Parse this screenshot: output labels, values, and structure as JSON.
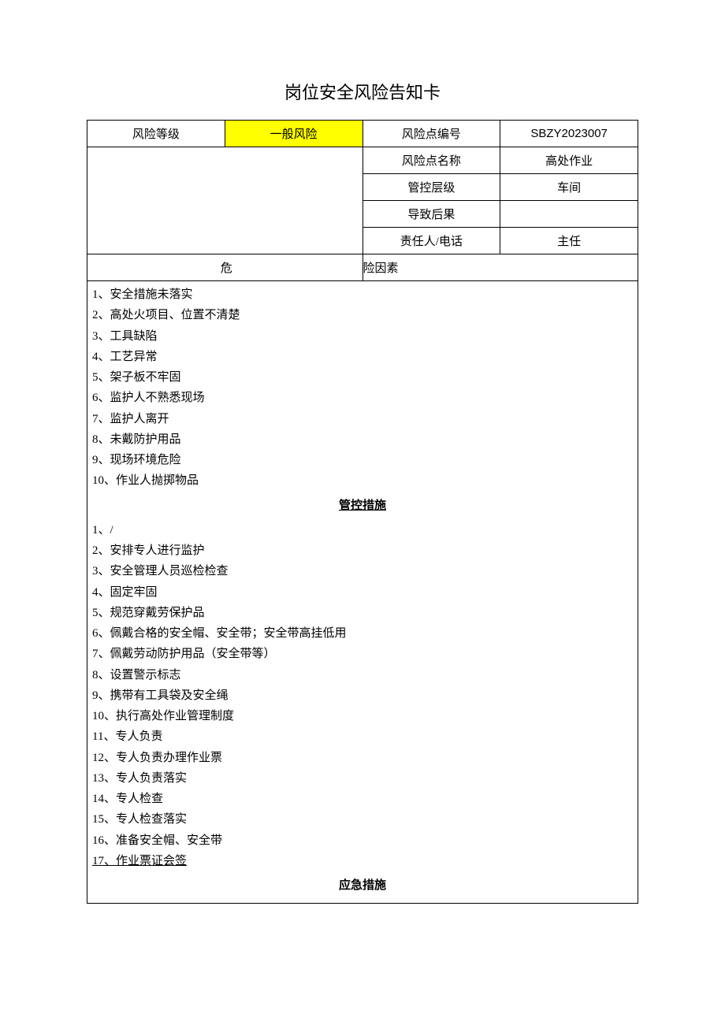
{
  "title": "岗位安全风险告知卡",
  "header": {
    "risk_level_label": "风险等级",
    "risk_level_value": "一般风险",
    "risk_point_no_label": "风险点编号",
    "risk_point_no_value": "SBZY2023007",
    "risk_point_name_label": "风险点名称",
    "risk_point_name_value": "高处作业",
    "control_level_label": "管控层级",
    "control_level_value": "车间",
    "consequence_label": "导致后果",
    "consequence_value": "",
    "responsible_label": "责任人/电话",
    "responsible_value": "主任"
  },
  "hazard": {
    "header_left": "危",
    "header_right": "险因素",
    "items": [
      "1、安全措施未落实",
      "2、高处火项目、位置不清楚",
      "3、工具缺陷",
      "4、工艺异常",
      "5、架子板不牢固",
      "6、监护人不熟悉现场",
      "7、监护人离开",
      "8、未戴防护用品",
      "9、现场环境危险",
      "10、作业人抛掷物品"
    ]
  },
  "control": {
    "header": "管控措施",
    "items": [
      "1、/",
      "2、安排专人进行监护",
      "3、安全管理人员巡检检查",
      "4、固定牢固",
      "5、规范穿戴劳保护品",
      "6、佩戴合格的安全帽、安全带；安全带高挂低用",
      "7、佩戴劳动防护用品（安全带等）",
      "8、设置警示标志",
      "9、携带有工具袋及安全绳",
      "10、执行高处作业管理制度",
      "11、专人负责",
      "12、专人负责办理作业票",
      "13、专人负责落实",
      "14、专人检查",
      "15、专人检查落实",
      "16、准备安全帽、安全带"
    ],
    "last_item": "17、作业票证会签"
  },
  "emergency": {
    "header": "应急措施"
  }
}
